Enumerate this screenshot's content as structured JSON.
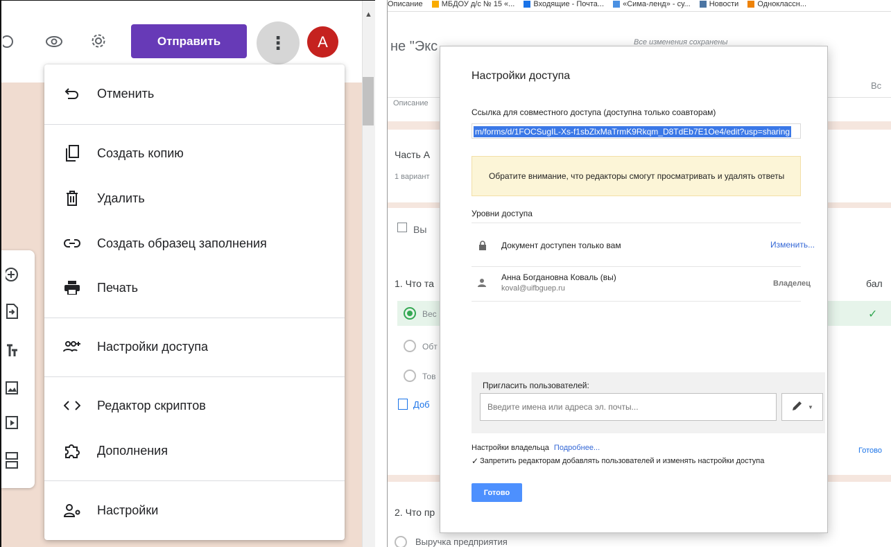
{
  "left": {
    "toolbar": {
      "send_label": "Отправить",
      "avatar_letter": "A",
      "more_glyph": "⋮"
    },
    "menu": {
      "items": [
        {
          "label": "Отменить",
          "icon": "undo-icon"
        },
        {
          "label": "Создать копию",
          "icon": "copy-icon"
        },
        {
          "label": "Удалить",
          "icon": "trash-icon"
        },
        {
          "label": "Создать образец заполнения",
          "icon": "link-icon"
        },
        {
          "label": "Печать",
          "icon": "print-icon"
        },
        {
          "label": "Настройки доступа",
          "icon": "add-people-icon"
        },
        {
          "label": "Редактор скриптов",
          "icon": "code-icon"
        },
        {
          "label": "Дополнения",
          "icon": "puzzle-icon"
        },
        {
          "label": "Настройки",
          "icon": "person-settings-icon"
        }
      ]
    },
    "colors": {
      "accent": "#673ab7",
      "avatar": "#c5221f",
      "background": "#f0dcd0"
    }
  },
  "right": {
    "bookmarks": [
      "Описание",
      "МБДОУ д/с № 15 «...",
      "Входящие - Почта...",
      "«Сима-ленд» - су...",
      "Новости",
      "Одноклассн..."
    ],
    "background": {
      "title_fragment": "не \"Экс",
      "saved_status": "Все изменения сохранены",
      "top_right": "Вс",
      "description": "Описание",
      "section": "Часть А",
      "variant": "1 вариант",
      "question_label": "Вы",
      "q1": "1. Что та",
      "opt1": "Вес",
      "opt2": "Обт",
      "opt3": "Тов",
      "add_option": "Доб",
      "points": "бал",
      "ready": "Готово",
      "q2": "2. Что пр",
      "bottom_option": "Выручка предприятия"
    },
    "dialog": {
      "title": "Настройки доступа",
      "link_label": "Ссылка для совместного доступа (доступна только соавторам)",
      "link_value": "m/forms/d/1FOCSugIL-Xs-f1sbZlxMaTrmK9Rkqm_D8TdEb7E1Oe4/edit?usp=sharing",
      "notice": "Обратите внимание, что редакторы смогут просматривать и удалять ответы",
      "levels_title": "Уровни доступа",
      "access_text": "Документ доступен только вам",
      "change_link": "Изменить...",
      "user_name": "Анна Богдановна Коваль (вы)",
      "user_email": "koval@uifbguep.ru",
      "user_role": "Владелец",
      "invite_label": "Пригласить пользователей:",
      "invite_placeholder": "Введите имена или адреса эл. почты...",
      "owner_settings": "Настройки владельца",
      "more_link": "Подробнее...",
      "restrict_label": "Запретить редакторам добавлять пользователей и изменять настройки доступа",
      "restrict_checked": true,
      "done_label": "Готово"
    }
  }
}
